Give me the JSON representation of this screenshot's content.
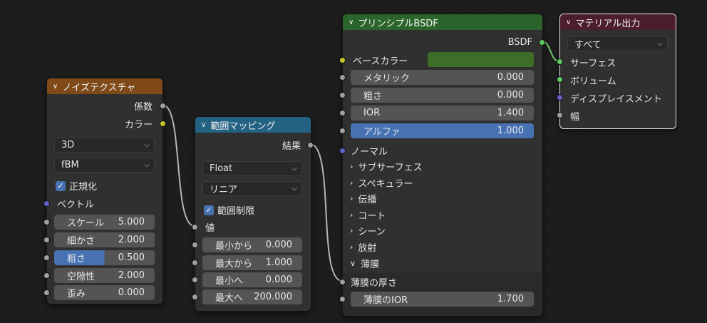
{
  "noise": {
    "title": "ノイズテクスチャ",
    "header_color": "#7f4918",
    "outputs": [
      "係数",
      "カラー"
    ],
    "dimension": "3D",
    "type": "fBM",
    "normalize_label": "正規化",
    "normalize_checked": true,
    "vector_label": "ベクトル",
    "fields": [
      {
        "label": "スケール",
        "value": "5.000"
      },
      {
        "label": "細かさ",
        "value": "2.000"
      },
      {
        "label": "粗さ",
        "value": "0.500",
        "fraction": 0.5
      },
      {
        "label": "空隙性",
        "value": "2.000"
      },
      {
        "label": "歪み",
        "value": "0.000"
      }
    ]
  },
  "map_range": {
    "title": "範囲マッピング",
    "header_color": "#246283",
    "output": "結果",
    "data_type": "Float",
    "interpolation": "リニア",
    "clamp_label": "範囲制限",
    "clamp_checked": true,
    "value_label": "値",
    "fields": [
      {
        "label": "最小から",
        "value": "0.000"
      },
      {
        "label": "最大から",
        "value": "1.000"
      },
      {
        "label": "最小へ",
        "value": "0.000"
      },
      {
        "label": "最大へ",
        "value": "200.000"
      }
    ]
  },
  "bsdf": {
    "title": "プリンシプルBSDF",
    "header_color": "#2b652b",
    "output": "BSDF",
    "base_color_label": "ベースカラー",
    "base_color_swatch": "#3c6e28",
    "fields": [
      {
        "label": "メタリック",
        "value": "0.000"
      },
      {
        "label": "粗さ",
        "value": "0.000"
      },
      {
        "label": "IOR",
        "value": "1.400"
      },
      {
        "label": "アルファ",
        "value": "1.000",
        "fraction": 1.0
      }
    ],
    "normal_label": "ノーマル",
    "panels": [
      "サブサーフェス",
      "スペキュラー",
      "伝播",
      "コート",
      "シーン",
      "放射"
    ],
    "thin_film_panel": "薄膜",
    "thin_film_thickness_label": "薄膜の厚さ",
    "thin_film_ior": {
      "label": "薄膜のIOR",
      "value": "1.700"
    }
  },
  "output": {
    "title": "マテリアル出力",
    "header_color": "#4c1e2b",
    "target": "すべて",
    "inputs": [
      "サーフェス",
      "ボリューム",
      "ディスプレイスメント",
      "幅"
    ]
  },
  "socket_colors": {
    "float": "#a1a1a1",
    "color": "#c7c729",
    "vector": "#6363c7",
    "shader": "#63c763"
  }
}
